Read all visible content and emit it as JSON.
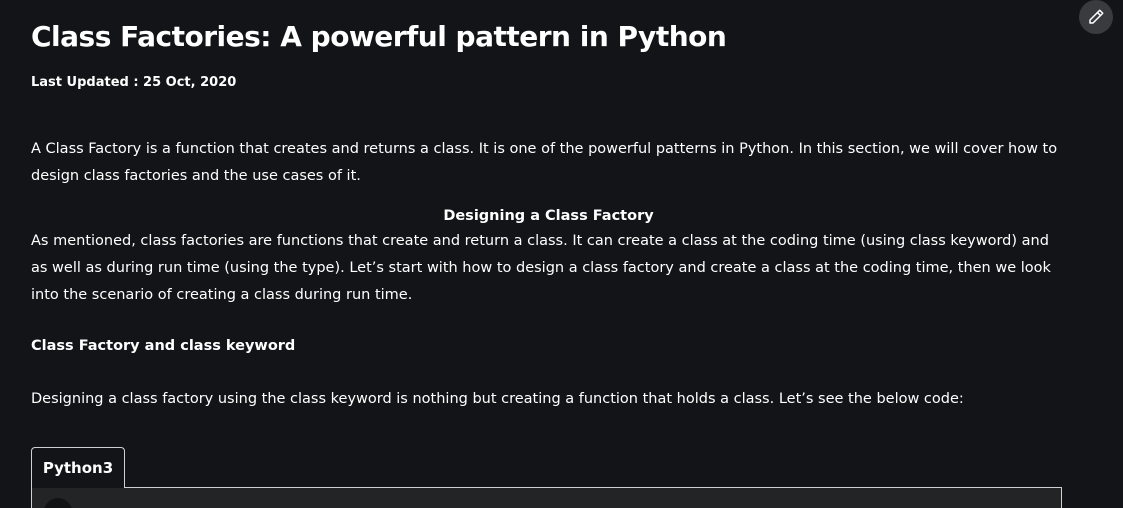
{
  "article": {
    "title": "Class Factories: A powerful pattern in Python",
    "last_updated": "Last Updated : 25 Oct, 2020",
    "intro": "A Class Factory is a function that creates and returns a class. It is one of the powerful patterns in Python. In this section, we will cover how to design class factories and the use cases of it.",
    "section_heading": "Designing a Class Factory",
    "section_text": "As mentioned, class factories are functions that create and return a class. It can create a class at the coding time (using class keyword) and as well as during run time (using the type). Let’s start with how to design a class factory and create a class at the coding time, then we look into the scenario of creating a class during run time.",
    "subheading": "Class Factory and class keyword",
    "subheading_text": "Designing a class factory using the class keyword is nothing but creating a function that holds a class. Let’s see the below code:"
  },
  "code_block": {
    "tab_label": "Python3"
  },
  "toolbar": {
    "edit_icon": "pencil-icon"
  },
  "colors": {
    "background": "#131417",
    "text": "#ffffff",
    "edit_button": "#3a3b3f",
    "code_background": "#232425",
    "border": "#d0d0d0"
  }
}
